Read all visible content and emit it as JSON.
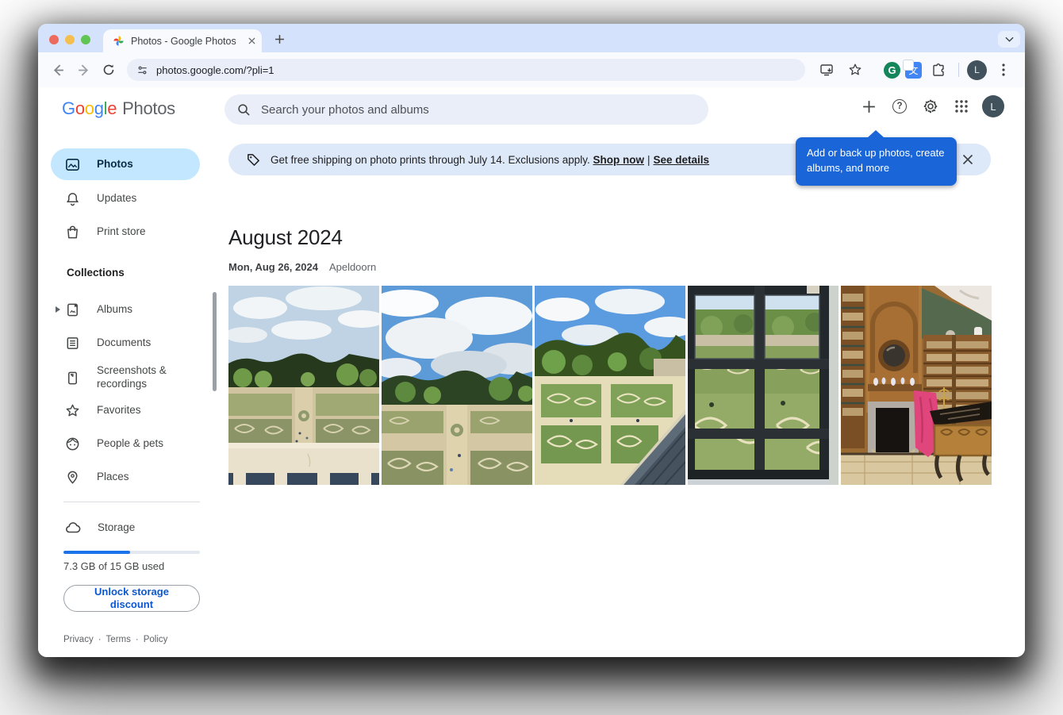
{
  "browser": {
    "tab_title": "Photos - Google Photos",
    "url": "photos.google.com/?pli=1",
    "profile_initial": "L"
  },
  "header": {
    "logo_letters": [
      "G",
      "o",
      "o",
      "g",
      "l",
      "e"
    ],
    "logo_suffix": "Photos",
    "search_placeholder": "Search your photos and albums",
    "help_glyph": "?",
    "profile_initial": "L"
  },
  "extensions": {
    "grammarly_glyph": "G",
    "translate_glyph": "文"
  },
  "tooltip": {
    "text": "Add or back up photos, create albums, and more"
  },
  "banner": {
    "text": "Get free shipping on photo prints through July 14. Exclusions apply.",
    "link_shop": "Shop now",
    "separator": "|",
    "link_details": "See details"
  },
  "sidebar": {
    "items": [
      {
        "label": "Photos"
      },
      {
        "label": "Updates"
      },
      {
        "label": "Print store"
      }
    ],
    "collections_header": "Collections",
    "collections": [
      {
        "label": "Albums"
      },
      {
        "label": "Documents"
      },
      {
        "label": "Screenshots & recordings"
      },
      {
        "label": "Favorites"
      },
      {
        "label": "People & pets"
      },
      {
        "label": "Places"
      }
    ],
    "storage": {
      "label": "Storage",
      "percent": 49,
      "used_text": "7.3 GB of 15 GB used",
      "button_label": "Unlock storage discount"
    },
    "footer_links": [
      "Privacy",
      "Terms",
      "Policy"
    ],
    "footer_separator": "·"
  },
  "main": {
    "month_title": "August 2024",
    "date_label": "Mon, Aug 26, 2024",
    "location": "Apeldoorn",
    "photos": [
      {
        "label": "Baroque garden viewed over palace balustrade"
      },
      {
        "label": "Garden parterres under blue sky with clouds"
      },
      {
        "label": "Garden parterres beside slate palace roof"
      },
      {
        "label": "Garden seen through window panes"
      },
      {
        "label": "Historic library with fireplace, pink cloth and desk"
      }
    ]
  },
  "colors": {
    "accent_blue": "#1a73e8",
    "tooltip_blue": "#1a66d8",
    "active_pill": "#c2e7ff",
    "banner_bg": "#dde8f9"
  }
}
